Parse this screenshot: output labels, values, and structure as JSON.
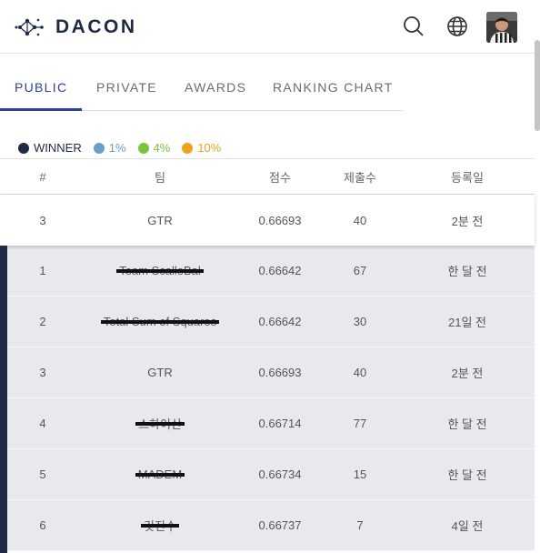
{
  "brand": {
    "name": "DACON"
  },
  "header": {
    "search_icon": "search-icon",
    "language_icon": "globe-icon",
    "avatar": "user-avatar"
  },
  "tabs": [
    {
      "label": "PUBLIC",
      "active": true
    },
    {
      "label": "PRIVATE",
      "active": false
    },
    {
      "label": "AWARDS",
      "active": false
    },
    {
      "label": "RANKING CHART",
      "active": false
    }
  ],
  "legend": [
    {
      "label": "WINNER",
      "color": "#1f2a44"
    },
    {
      "label": "1%",
      "color": "#6a9fc9"
    },
    {
      "label": "4%",
      "color": "#7cc23c"
    },
    {
      "label": "10%",
      "color": "#f0a21f"
    }
  ],
  "table": {
    "headers": {
      "rank": "#",
      "team": "팀",
      "score": "점수",
      "submissions": "제출수",
      "date": "등록일"
    },
    "my_row": {
      "rank": "3",
      "team": "GTR",
      "score": "0.66693",
      "submissions": "40",
      "date": "2분 전"
    },
    "rows": [
      {
        "rank": "1",
        "team": "Team ScalleBal",
        "score": "0.66642",
        "submissions": "67",
        "date": "한 달 전",
        "struck": true
      },
      {
        "rank": "2",
        "team": "Total Sum of Squares",
        "score": "0.66642",
        "submissions": "30",
        "date": "21일 전",
        "struck": true
      },
      {
        "rank": "3",
        "team": "GTR",
        "score": "0.66693",
        "submissions": "40",
        "date": "2분 전",
        "struck": false
      },
      {
        "rank": "4",
        "team": "스하이산",
        "score": "0.66714",
        "submissions": "77",
        "date": "한 달 전",
        "struck": true
      },
      {
        "rank": "5",
        "team": "MADEM",
        "score": "0.66734",
        "submissions": "15",
        "date": "한 달 전",
        "struck": true
      },
      {
        "rank": "6",
        "team": "깃진수",
        "score": "0.66737",
        "submissions": "7",
        "date": "4일 전",
        "struck": true
      }
    ]
  }
}
